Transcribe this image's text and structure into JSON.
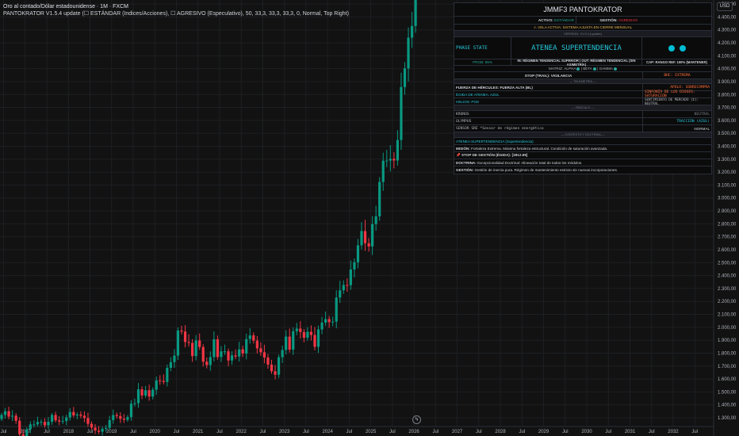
{
  "legend": {
    "symbol_line": "Oro al contado/Dólar estadounidense · 1M · FXCM",
    "indicator_line": "PANTOKRATOR V1.5.4 update (☐ ESTÁNDAR (Indices/Acciones), ☐ AGRESIVO (Especulativo), 50, 33,3, 33,3, 33,3, 0, Normal, Top Right)"
  },
  "currency": "USD",
  "panel": {
    "title": "JMMF3 PANTOKRATOR",
    "activo_label": "ACTIVO:",
    "activo_value": "ESTÁNDAR",
    "gestion_label": "GESTIÓN:",
    "gestion_value": "AGRESIVO",
    "vela_activa": "⚠ VELA ACTIVA: SISTEMA AJUSTA EN CIERRE MENSUAL",
    "version": "VERSION: V1.5.4 (update)",
    "phase_state_label": "PHASE STATE",
    "phase_state_value": "ATENEA SUPERTENDENCIA",
    "prob": "PROB: 85%",
    "regimen": "IN: RÉGIMEN TENDENCIAL SUPERIOR | OUT: RÉGIMEN TENDENCIAL (SIN ASIMETRÍA)",
    "cap": "CAP: RANGO REF. 100% (MANTENER)",
    "matriz_label": "MATRIZ:",
    "alpha": "ALPHA",
    "beta": "BETA",
    "gamma": "GAMMA",
    "stop_trail": "STOP (TRAIL): VIGILANCIA",
    "bhc": "BHC: EXTREMA",
    "telemetria": "— TELEMETRÍA —",
    "fuerza": "FUERZA DE HÉRCULES: FUERZA ALTA (BL)",
    "apolo": "APOLO: SOBRECOMPRA",
    "egida": "ÉGIDA DE ATENEA: AZUL",
    "sinfonia": "SINFONÍA DE LOS DIOSES: SATURACIÓN",
    "helios": "HELIOS: POS",
    "sentimiento": "SENTIMIENTO DE MERCADO (Σ): NEUTRAL",
    "oraculo": "— ORÁCULO —",
    "kronos": "KRONOS",
    "kronos_value": "NEUTRAL",
    "olympus": "OLYMPUS",
    "olympus_value": "TRACCIÓN (AZUL)",
    "sensor": "SENSOR SRE *Sensor de régimen energético",
    "sensor_value": "NORMAL",
    "contexto": "— CONTEXTO Y DOCTRINA —",
    "atenea_line": "ATENEA SUPERTENDENCIA (Supertendencia)",
    "mision_label": "MISIÓN:",
    "mision": "Fortaleza Extrema. Máxima fortaleza estructural. Condición de saturación avanzada.",
    "stop_gestion": "📌 STOP DE GESTIÓN (ÉGIDA): [3912.99]",
    "doctrina_label": "DOCTRINA:",
    "doctrina": "Excepcionalidad Doctrinal: Alineación total de todos los módulos.",
    "gestion2_label": "GESTIÓN:",
    "gestion2": "Gestión de inercia pura. Régimen de mantenimiento estricto sin nuevas incorporaciones."
  },
  "colors": {
    "up": "#089981",
    "down": "#f23645",
    "grid": "#1e1f23",
    "teal": "#00bcd4"
  },
  "chart_data": {
    "type": "candlestick",
    "title": "Oro al contado/Dólar estadounidense · 1M · FXCM",
    "interval": "1M",
    "start": "2016-06",
    "first_open": 1290,
    "closes": [
      1322,
      1351,
      1309,
      1316,
      1277,
      1173,
      1152,
      1211,
      1249,
      1249,
      1268,
      1268,
      1242,
      1269,
      1322,
      1280,
      1271,
      1275,
      1303,
      1345,
      1318,
      1325,
      1316,
      1298,
      1253,
      1224,
      1201,
      1192,
      1215,
      1222,
      1282,
      1321,
      1313,
      1292,
      1284,
      1305,
      1409,
      1413,
      1520,
      1472,
      1513,
      1464,
      1517,
      1589,
      1585,
      1577,
      1686,
      1730,
      1781,
      1975,
      1967,
      1886,
      1879,
      1777,
      1898,
      1847,
      1734,
      1708,
      1769,
      1907,
      1770,
      1814,
      1814,
      1743,
      1783,
      1774,
      1829,
      1797,
      1909,
      1937,
      1897,
      1837,
      1807,
      1766,
      1711,
      1660,
      1633,
      1768,
      1824,
      1928,
      1827,
      1969,
      1990,
      1963,
      1919,
      1965,
      1940,
      1849,
      1983,
      2036,
      2063,
      2040,
      2044,
      2230,
      2286,
      2327,
      2326,
      2447,
      2503,
      2634,
      2744,
      2650,
      2625,
      2798,
      2858,
      3124,
      3288,
      3289,
      3303,
      3290,
      3448,
      3858,
      4002,
      4240,
      4330,
      4700
    ],
    "y_ticks": [
      "4.500,00",
      "4.400,00",
      "4.300,00",
      "4.200,00",
      "4.100,00",
      "4.000,00",
      "3.900,00",
      "3.800,00",
      "3.700,00",
      "3.600,00",
      "3.500,00",
      "3.400,00",
      "3.300,00",
      "3.200,00",
      "3.100,00",
      "3.000,00",
      "2.900,00",
      "2.800,00",
      "2.700,00",
      "2.600,00",
      "2.500,00",
      "2.400,00",
      "2.300,00",
      "2.200,00",
      "2.100,00",
      "2.000,00",
      "1.900,00",
      "1.800,00",
      "1.700,00",
      "1.600,00",
      "1.500,00",
      "1.400,00",
      "1.300,00"
    ],
    "y_tick_values": [
      4500,
      4400,
      4300,
      4200,
      4100,
      4000,
      3900,
      3800,
      3700,
      3600,
      3500,
      3400,
      3300,
      3200,
      3100,
      3000,
      2900,
      2800,
      2700,
      2600,
      2500,
      2400,
      2300,
      2200,
      2100,
      2000,
      1900,
      1800,
      1700,
      1600,
      1500,
      1400,
      1300
    ],
    "x_ticks": [
      "Jul",
      "2017",
      "Jul",
      "2018",
      "Jul",
      "2019",
      "Jul",
      "2020",
      "Jul",
      "2021",
      "Jul",
      "2022",
      "Jul",
      "2023",
      "Jul",
      "2024",
      "Jul",
      "2025",
      "Jul",
      "2026",
      "Jul",
      "2027",
      "Jul",
      "2028",
      "Jul",
      "2029",
      "Jul",
      "2030",
      "Jul",
      "2031",
      "Jul",
      "2032",
      "Jul"
    ],
    "x_tick_months": [
      1,
      7,
      13,
      19,
      25,
      31,
      37,
      43,
      49,
      55,
      61,
      67,
      73,
      79,
      85,
      91,
      97,
      103,
      109,
      115,
      121,
      127,
      133,
      139,
      145,
      151,
      157,
      163,
      169,
      175,
      181,
      187,
      193
    ],
    "ylim": [
      1280,
      4520
    ]
  }
}
